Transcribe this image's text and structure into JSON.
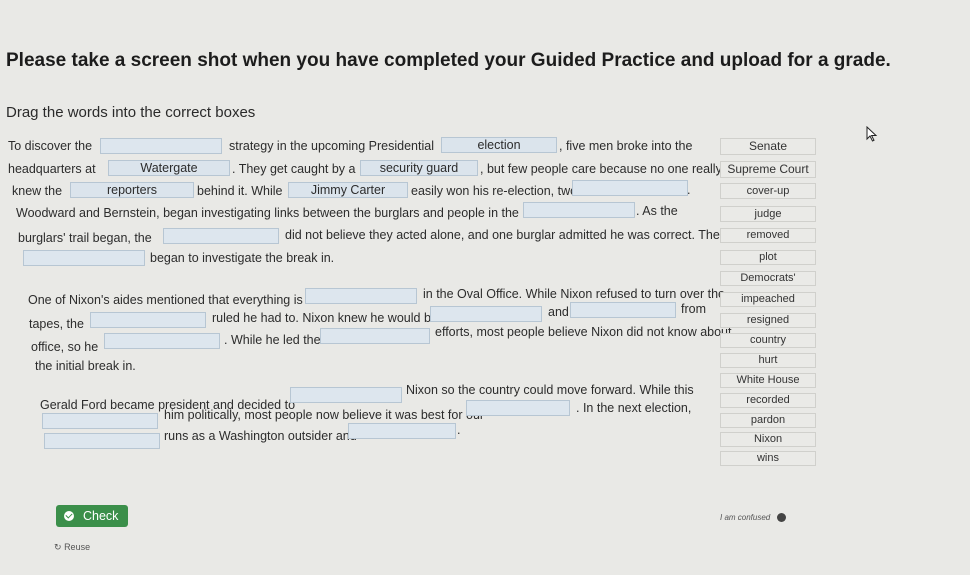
{
  "header": {
    "title": "Please take a screen shot when you have completed your Guided Practice and upload for a grade.",
    "instructions": "Drag the words into the correct boxes"
  },
  "passage": {
    "p1_t1": "To discover the",
    "p1_t2": "strategy in the upcoming Presidential",
    "p1_t3": ", five men broke into the",
    "p1_t4": "headquarters at",
    "p1_t5": ". They get caught by a",
    "p1_t6": ", but few people care because no one really",
    "p1_t7": "knew the",
    "p1_t8": "behind it. While",
    "p1_t9": "easily won his re-election, two",
    "p1_t10": ".",
    "p1_t11": "Woodward and Bernstein, began investigating links between the burglars and people in the",
    "p1_t12": ". As the",
    "p1_t13": "burglars' trail began, the",
    "p1_t14": "did not believe they acted alone, and one burglar admitted he was correct. The",
    "p1_t15": "began to investigate the break in.",
    "p2_t1": "One of Nixon's aides mentioned that everything is",
    "p2_t2": "in the Oval Office. While Nixon refused to turn over the",
    "p2_t3": "tapes, the",
    "p2_t4": "ruled he had to. Nixon knew he would be",
    "p2_t5": "and",
    "p2_t6": "from",
    "p2_t7": "office, so he",
    "p2_t8": ". While he led the",
    "p2_t9": "efforts, most people believe Nixon did not know about",
    "p2_t10": "the initial break in.",
    "p3_t1": "Gerald Ford became president and decided to",
    "p3_t2": "Nixon so the country could move forward. While this",
    "p3_t3": "him politically, most people now believe it was best for our",
    "p3_t4": ". In the next election,",
    "p3_t5": "runs as a Washington outsider and",
    "p3_t6": "."
  },
  "filled": {
    "election": "election",
    "watergate": "Watergate",
    "security_guard": "security guard",
    "reporters": "reporters",
    "jimmy_carter": "Jimmy Carter"
  },
  "word_bank": [
    "Senate",
    "Supreme Court",
    "cover-up",
    "judge",
    "removed",
    "plot",
    "Democrats'",
    "impeached",
    "resigned",
    "country",
    "hurt",
    "White House",
    "recorded",
    "pardon",
    "Nixon",
    "wins"
  ],
  "buttons": {
    "check_label": "Check",
    "reuse_label": "Reuse",
    "confused_label": "I am confused"
  }
}
